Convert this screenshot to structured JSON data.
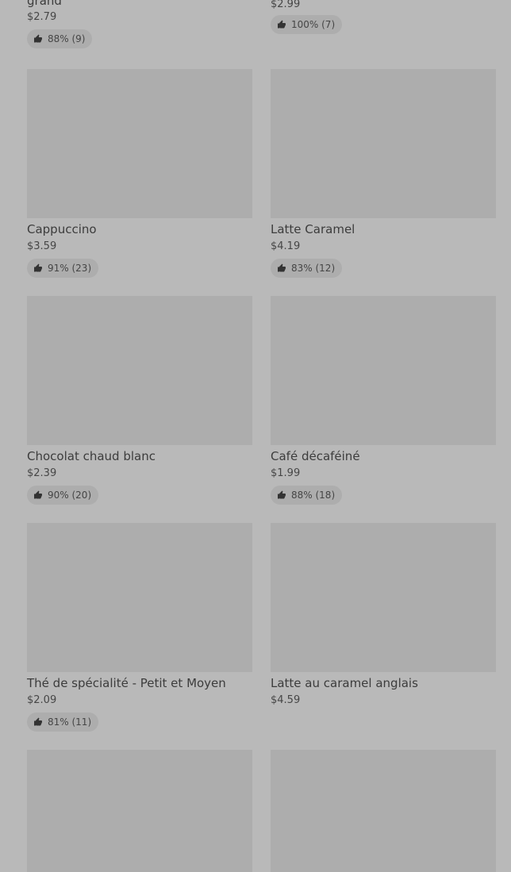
{
  "products": [
    {
      "name": "grand",
      "price": "$2.79",
      "rating": "88% (9)"
    },
    {
      "name": "",
      "price": "$2.99",
      "rating": "100% (7)"
    },
    {
      "name": "Cappuccino",
      "price": "$3.59",
      "rating": "91% (23)"
    },
    {
      "name": "Latte Caramel",
      "price": "$4.19",
      "rating": "83% (12)"
    },
    {
      "name": "Chocolat chaud blanc",
      "price": "$2.39",
      "rating": "90% (20)"
    },
    {
      "name": "Café décaféiné",
      "price": "$1.99",
      "rating": "88% (18)"
    },
    {
      "name": "Thé de spécialité - Petit et Moyen",
      "price": "$2.09",
      "rating": "81% (11)"
    },
    {
      "name": "Latte au caramel anglais",
      "price": "$4.59"
    },
    {},
    {}
  ]
}
